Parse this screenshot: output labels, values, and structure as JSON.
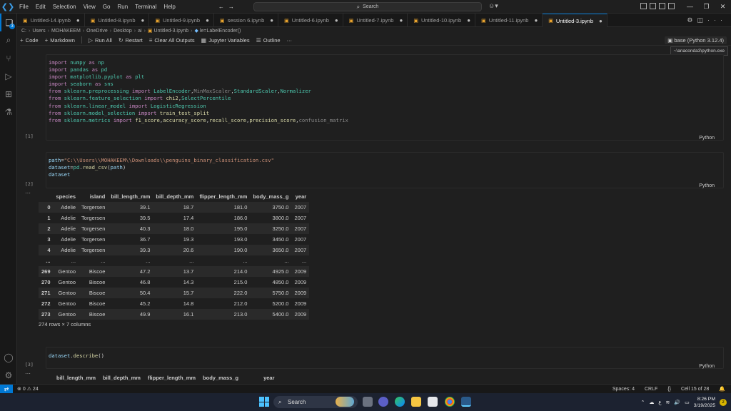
{
  "window": {
    "menu": [
      "File",
      "Edit",
      "Selection",
      "View",
      "Go",
      "Run",
      "Terminal",
      "Help"
    ],
    "search_label": "Search"
  },
  "activity_badge": "3",
  "tabs": [
    {
      "label": "Untitled-14.ipynb",
      "active": false
    },
    {
      "label": "Untitled-8.ipynb",
      "active": false
    },
    {
      "label": "Untitled-9.ipynb",
      "active": false
    },
    {
      "label": "session 6.ipynb",
      "active": false
    },
    {
      "label": "Untitled-6.ipynb",
      "active": false
    },
    {
      "label": "Untitled-7.ipynb",
      "active": false
    },
    {
      "label": "Untitled-10.ipynb",
      "active": false
    },
    {
      "label": "Untitled-11.ipynb",
      "active": false
    },
    {
      "label": "Untitled-3.ipynb",
      "active": true
    }
  ],
  "breadcrumb": [
    "C:",
    "Users",
    "MOHAKEEM",
    "OneDrive",
    "Desktop",
    "ai",
    "Untitled-3.ipynb",
    "le=LabelEncoder()"
  ],
  "toolbar": {
    "code": "Code",
    "markdown": "Markdown",
    "run_all": "Run All",
    "restart": "Restart",
    "clear_outputs": "Clear All Outputs",
    "variables": "Jupyter Variables",
    "outline": "Outline",
    "more": "···"
  },
  "kernel": {
    "label": "base (Python 3.12.4)",
    "tooltip": "~\\anaconda3\\python.exe"
  },
  "cells": {
    "cell1": {
      "count": "[1]",
      "lang": "Python",
      "lines": [
        [
          [
            "kw",
            "import"
          ],
          [
            "t",
            " "
          ],
          [
            "mod",
            "numpy"
          ],
          [
            "t",
            " "
          ],
          [
            "kw",
            "as"
          ],
          [
            "t",
            " "
          ],
          [
            "mod",
            "np"
          ]
        ],
        [
          [
            "kw",
            "import"
          ],
          [
            "t",
            " "
          ],
          [
            "mod",
            "pandas"
          ],
          [
            "t",
            " "
          ],
          [
            "kw",
            "as"
          ],
          [
            "t",
            " "
          ],
          [
            "mod",
            "pd"
          ]
        ],
        [
          [
            "kw",
            "import"
          ],
          [
            "t",
            " "
          ],
          [
            "mod",
            "matplotlib.pyplot"
          ],
          [
            "t",
            " "
          ],
          [
            "kw",
            "as"
          ],
          [
            "t",
            " "
          ],
          [
            "mod",
            "plt"
          ]
        ],
        [
          [
            "kw",
            "import"
          ],
          [
            "t",
            " "
          ],
          [
            "mod",
            "seaborn"
          ],
          [
            "t",
            " "
          ],
          [
            "kw",
            "as"
          ],
          [
            "t",
            " "
          ],
          [
            "mod",
            "sns"
          ]
        ],
        [
          [
            "kw",
            "from"
          ],
          [
            "t",
            " "
          ],
          [
            "mod",
            "sklearn.preprocessing"
          ],
          [
            "t",
            " "
          ],
          [
            "kw",
            "import"
          ],
          [
            "t",
            " "
          ],
          [
            "cls",
            "LabelEncoder"
          ],
          [
            "t",
            ","
          ],
          [
            "dim",
            "MinMaxScaler"
          ],
          [
            "t",
            ","
          ],
          [
            "cls",
            "StandardScaler"
          ],
          [
            "t",
            ","
          ],
          [
            "cls",
            "Normalizer"
          ]
        ],
        [
          [
            "kw",
            "from"
          ],
          [
            "t",
            " "
          ],
          [
            "mod",
            "sklearn.feature_selection"
          ],
          [
            "t",
            " "
          ],
          [
            "kw",
            "import"
          ],
          [
            "t",
            " "
          ],
          [
            "fn",
            "chi2"
          ],
          [
            "t",
            ","
          ],
          [
            "cls",
            "SelectPercentile"
          ]
        ],
        [
          [
            "kw",
            "from"
          ],
          [
            "t",
            " "
          ],
          [
            "mod",
            "sklearn.linear_model"
          ],
          [
            "t",
            " "
          ],
          [
            "kw",
            "import"
          ],
          [
            "t",
            " "
          ],
          [
            "cls",
            "LogisticRegression"
          ]
        ],
        [
          [
            "kw",
            "from"
          ],
          [
            "t",
            " "
          ],
          [
            "mod",
            "sklearn.model_selection"
          ],
          [
            "t",
            " "
          ],
          [
            "kw",
            "import"
          ],
          [
            "t",
            " "
          ],
          [
            "fn",
            "train_test_split"
          ]
        ],
        [
          [
            "kw",
            "from"
          ],
          [
            "t",
            " "
          ],
          [
            "mod",
            "sklearn.metrics"
          ],
          [
            "t",
            " "
          ],
          [
            "kw",
            "import"
          ],
          [
            "t",
            " "
          ],
          [
            "fn",
            "f1_score"
          ],
          [
            "t",
            ","
          ],
          [
            "fn",
            "accuracy_score"
          ],
          [
            "t",
            ","
          ],
          [
            "fn",
            "recall_score"
          ],
          [
            "t",
            ","
          ],
          [
            "fn",
            "precision_score"
          ],
          [
            "t",
            ","
          ],
          [
            "dim",
            "confusion_matrix"
          ]
        ]
      ]
    },
    "cell2": {
      "count": "[2]",
      "lang": "Python",
      "lines": [
        [
          [
            "var",
            "path"
          ],
          [
            "t",
            "="
          ],
          [
            "str",
            "\"C:\\\\Users\\\\MOHAKEEM\\\\Downloads\\\\penguins_binary_classification.csv\""
          ]
        ],
        [
          [
            "var",
            "dataset"
          ],
          [
            "t",
            "="
          ],
          [
            "mod",
            "pd"
          ],
          [
            "t",
            "."
          ],
          [
            "fn",
            "read_csv"
          ],
          [
            "t",
            "("
          ],
          [
            "var",
            "path"
          ],
          [
            "t",
            ")"
          ]
        ],
        [
          [
            "var",
            "dataset"
          ]
        ]
      ]
    },
    "cell3": {
      "count": "[3]",
      "lang": "Python",
      "lines": [
        [
          [
            "var",
            "dataset"
          ],
          [
            "t",
            "."
          ],
          [
            "fn",
            "describe"
          ],
          [
            "t",
            "()"
          ]
        ]
      ]
    }
  },
  "output_dots": "···",
  "dataframe": {
    "columns": [
      "",
      "species",
      "island",
      "bill_length_mm",
      "bill_depth_mm",
      "flipper_length_mm",
      "body_mass_g",
      "year"
    ],
    "rows": [
      [
        "0",
        "Adelie",
        "Torgersen",
        "39.1",
        "18.7",
        "181.0",
        "3750.0",
        "2007"
      ],
      [
        "1",
        "Adelie",
        "Torgersen",
        "39.5",
        "17.4",
        "186.0",
        "3800.0",
        "2007"
      ],
      [
        "2",
        "Adelie",
        "Torgersen",
        "40.3",
        "18.0",
        "195.0",
        "3250.0",
        "2007"
      ],
      [
        "3",
        "Adelie",
        "Torgersen",
        "36.7",
        "19.3",
        "193.0",
        "3450.0",
        "2007"
      ],
      [
        "4",
        "Adelie",
        "Torgersen",
        "39.3",
        "20.6",
        "190.0",
        "3650.0",
        "2007"
      ],
      [
        "...",
        "...",
        "...",
        "...",
        "...",
        "...",
        "...",
        "..."
      ],
      [
        "269",
        "Gentoo",
        "Biscoe",
        "47.2",
        "13.7",
        "214.0",
        "4925.0",
        "2009"
      ],
      [
        "270",
        "Gentoo",
        "Biscoe",
        "46.8",
        "14.3",
        "215.0",
        "4850.0",
        "2009"
      ],
      [
        "271",
        "Gentoo",
        "Biscoe",
        "50.4",
        "15.7",
        "222.0",
        "5750.0",
        "2009"
      ],
      [
        "272",
        "Gentoo",
        "Biscoe",
        "45.2",
        "14.8",
        "212.0",
        "5200.0",
        "2009"
      ],
      [
        "273",
        "Gentoo",
        "Biscoe",
        "49.9",
        "16.1",
        "213.0",
        "5400.0",
        "2009"
      ]
    ],
    "shape_note": "274 rows × 7 columns"
  },
  "describe_columns": [
    "",
    "bill_length_mm",
    "bill_depth_mm",
    "flipper_length_mm",
    "body_mass_g",
    "year"
  ],
  "statusbar": {
    "errors": "0",
    "warnings": "24",
    "spaces": "Spaces: 4",
    "eol": "CRLF",
    "cell_pos": "Cell 15 of 28"
  },
  "taskbar": {
    "search": "Search",
    "time": "8:26 PM",
    "date": "3/19/2025",
    "notifications": "2",
    "lang": "ع"
  },
  "colors": {
    "accent": "#0078d4",
    "keyword": "#c586c0",
    "module": "#4ec9b0",
    "function": "#dcdcaa",
    "string": "#ce9178"
  }
}
